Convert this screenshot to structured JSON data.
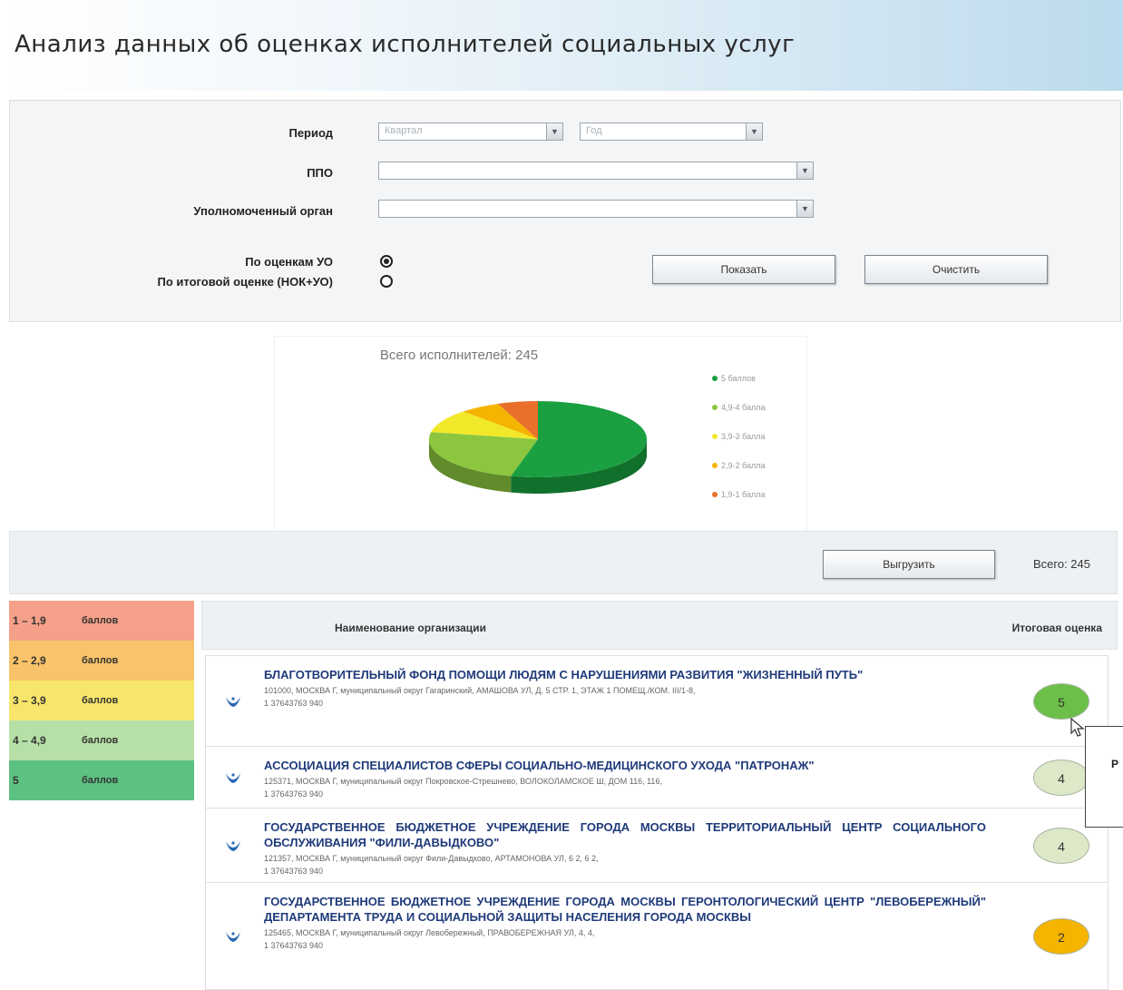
{
  "header": {
    "title": "Анализ данных об оценках исполнителей социальных услуг"
  },
  "filters": {
    "period_label": "Период",
    "quarter_placeholder": "Квартал",
    "year_placeholder": "Год",
    "ppo_label": "ППО",
    "ppo_value": "",
    "authority_label": "Уполномоченный орган",
    "authority_value": "",
    "radio_uo_label": "По оценкам УО",
    "radio_uo_checked": true,
    "radio_total_label": "По итоговой оценке (НОК+УО)",
    "radio_total_checked": false,
    "show_button": "Показать",
    "clear_button": "Очистить"
  },
  "chart_data": {
    "type": "pie",
    "title": "Всего исполнителей: 245",
    "categories": [
      "5 баллов",
      "4,9-4 балла",
      "3,9-3 балла",
      "2,9-2 балла",
      "1,9-1 балла"
    ],
    "values": [
      54,
      24,
      10,
      6,
      6
    ],
    "colors": [
      "#1aa040",
      "#8cc63e",
      "#f2e82a",
      "#f5b400",
      "#e8702a"
    ],
    "legend_position": "right"
  },
  "toolbar": {
    "export_button": "Выгрузить",
    "total_label": "Всего: 245"
  },
  "score_legend": [
    {
      "range": "1 – 1,9",
      "unit": "баллов",
      "color": "#f5a089"
    },
    {
      "range": "2 – 2,9",
      "unit": "баллов",
      "color": "#f8c36a"
    },
    {
      "range": "3 – 3,9",
      "unit": "баллов",
      "color": "#f7e66b"
    },
    {
      "range": "4 – 4,9",
      "unit": "баллов",
      "color": "#b7e0a6"
    },
    {
      "range": "5",
      "unit": "баллов",
      "color": "#5cc182"
    }
  ],
  "table": {
    "col_name": "Наименование организации",
    "col_score": "Итоговая оценка",
    "rows": [
      {
        "name": "БЛАГОТВОРИТЕЛЬНЫЙ ФОНД ПОМОЩИ ЛЮДЯМ С НАРУШЕНИЯМИ РАЗВИТИЯ \"ЖИЗНЕННЫЙ ПУТЬ\"",
        "address": "101000, МОСКВА Г, муниципальный округ Гагаринский, АМАШОВА УЛ, Д. 5 СТР. 1, ЭТАЖ 1 ПОМЕЩ./КОМ. III/1-8,",
        "code": "1 37643763 940",
        "score": "5",
        "color": "#6cc04a"
      },
      {
        "name": "АССОЦИАЦИЯ СПЕЦИАЛИСТОВ СФЕРЫ СОЦИАЛЬНО-МЕДИЦИНСКОГО УХОДА \"ПАТРОНАЖ\"",
        "address": "125371, МОСКВА Г, муниципальный округ Покровское-Стрешнево, ВОЛОКОЛАМСКОЕ Ш, ДОМ 116, 116,",
        "code": "1 37643763 940",
        "score": "4",
        "color": "#dce8c8"
      },
      {
        "name": "ГОСУДАРСТВЕННОЕ БЮДЖЕТНОЕ УЧРЕЖДЕНИЕ ГОРОДА МОСКВЫ ТЕРРИТОРИАЛЬНЫЙ ЦЕНТР СОЦИАЛЬНОГО ОБСЛУЖИВАНИЯ \"ФИЛИ-ДАВЫДКОВО\"",
        "address": "121357, МОСКВА Г, муниципальный округ Фили-Давыдково, АРТАМОНОВА УЛ, 6 2, 6 2,",
        "code": "1 37643763 940",
        "score": "4",
        "color": "#dce8c8"
      },
      {
        "name": "ГОСУДАРСТВЕННОЕ БЮДЖЕТНОЕ УЧРЕЖДЕНИЕ ГОРОДА МОСКВЫ ГЕРОНТОЛОГИЧЕСКИЙ ЦЕНТР \"ЛЕВОБЕРЕЖНЫЙ\" ДЕПАРТАМЕНТА ТРУДА И СОЦИАЛЬНОЙ ЗАЩИТЫ НАСЕЛЕНИЯ ГОРОДА МОСКВЫ",
        "address": "125465, МОСКВА Г, муниципальный округ Левобережный, ПРАВОБЕРЕЖНАЯ УЛ, 4, 4,",
        "code": "1 37643763 940",
        "score": "2",
        "color": "#f5b400"
      }
    ]
  },
  "tooltip": {
    "text": "Р"
  }
}
